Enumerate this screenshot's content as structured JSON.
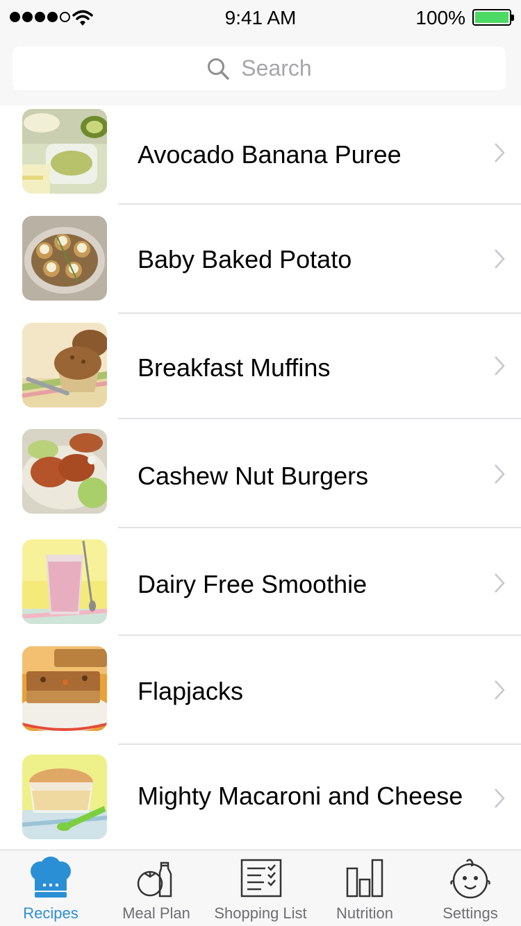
{
  "status_bar": {
    "time": "9:41 AM",
    "battery_percent": "100%"
  },
  "search": {
    "placeholder": "Search"
  },
  "recipes": [
    {
      "title": "Avocado Banana Puree"
    },
    {
      "title": "Baby Baked Potato"
    },
    {
      "title": "Breakfast Muffins"
    },
    {
      "title": "Cashew Nut Burgers"
    },
    {
      "title": "Dairy Free Smoothie"
    },
    {
      "title": "Flapjacks"
    },
    {
      "title": "Mighty Macaroni and Cheese"
    }
  ],
  "tabs": [
    {
      "label": "Recipes",
      "icon": "chef-hat-icon"
    },
    {
      "label": "Meal Plan",
      "icon": "tomato-bottle-icon"
    },
    {
      "label": "Shopping List",
      "icon": "checklist-icon"
    },
    {
      "label": "Nutrition",
      "icon": "bar-chart-icon"
    },
    {
      "label": "Settings",
      "icon": "baby-face-icon"
    }
  ],
  "colors": {
    "accent": "#2b8fd6",
    "battery": "#4cd964",
    "tab_inactive": "#6e6e73"
  }
}
